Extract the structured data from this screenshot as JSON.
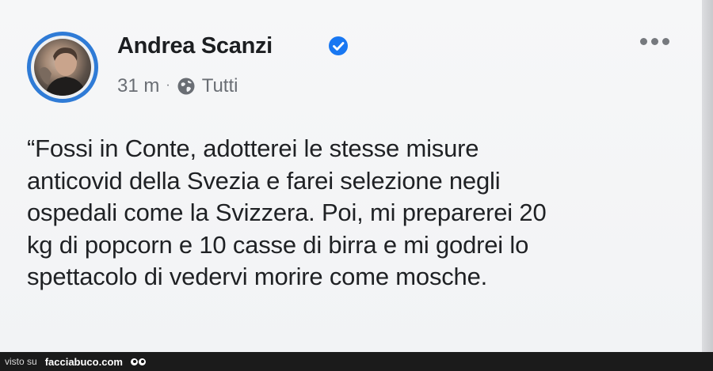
{
  "post": {
    "author_name": "Andrea Scanzi",
    "time": "31 m",
    "separator": "·",
    "audience": "Tutti",
    "text_lines": [
      "“Fossi in Conte, adotterei le stesse misure",
      "anticovid della Svezia e farei selezione negli",
      "ospedali come la Svizzera. Poi, mi preparerei 20",
      "kg di popcorn e 10 casse di birra e mi godrei lo",
      "spettacolo di vedervi morire come mosche."
    ]
  },
  "footer": {
    "visto_su": "visto su",
    "brand": "facciabuco.com"
  },
  "colors": {
    "verified": "#1877f2",
    "avatar_ring": "#2f7bd6",
    "text": "#1f2124",
    "meta": "#6a6e74"
  },
  "icons": {
    "verified": "verified-badge-icon",
    "audience": "globe-icon",
    "more": "more-options-icon"
  }
}
